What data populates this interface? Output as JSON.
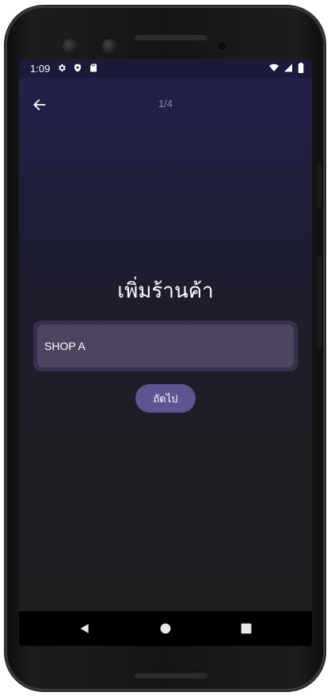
{
  "status_bar": {
    "time": "1:09",
    "icons_left": [
      "settings-gear-icon",
      "shield-icon",
      "sd-card-icon"
    ],
    "icons_right": [
      "wifi-icon",
      "cell-signal-icon",
      "battery-icon"
    ]
  },
  "header": {
    "back_icon": "arrow-left-icon",
    "step": "1/4"
  },
  "main": {
    "title": "เพิ่มร้านค้า",
    "shop_name_value": "SHOP A",
    "next_label": "ถัดไป"
  },
  "nav_bar": {
    "icons": [
      "back-triangle-icon",
      "home-circle-icon",
      "recents-square-icon"
    ]
  },
  "colors": {
    "status_bar": "#1a1a3a",
    "background_top": "#20204a",
    "background_bottom": "#1f1f22",
    "input_outer": "#3a2f4e",
    "input_inner": "#4d4460",
    "accent_button": "#5f5390",
    "step_text": "#8a8aa8"
  }
}
